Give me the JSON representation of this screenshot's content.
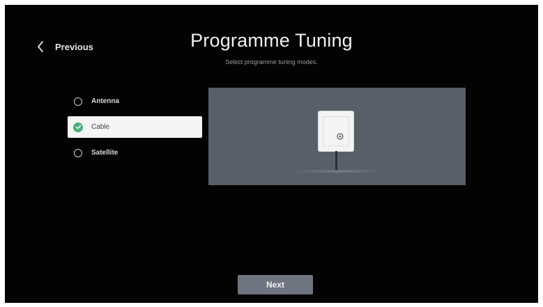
{
  "header": {
    "back_label": "Previous",
    "title": "Programme Tuning",
    "subtitle": "Select programme tuning modes."
  },
  "options": [
    {
      "label": "Antenna",
      "selected": false
    },
    {
      "label": "Cable",
      "selected": true
    },
    {
      "label": "Satellite",
      "selected": false
    }
  ],
  "illustration": {
    "icon": "wall-cable-socket-icon"
  },
  "footer": {
    "next_label": "Next"
  },
  "colors": {
    "screen_background": "#030303",
    "selected_check": "#4caf7a",
    "illustration_background": "#595f69",
    "next_button": "#6f7580"
  }
}
